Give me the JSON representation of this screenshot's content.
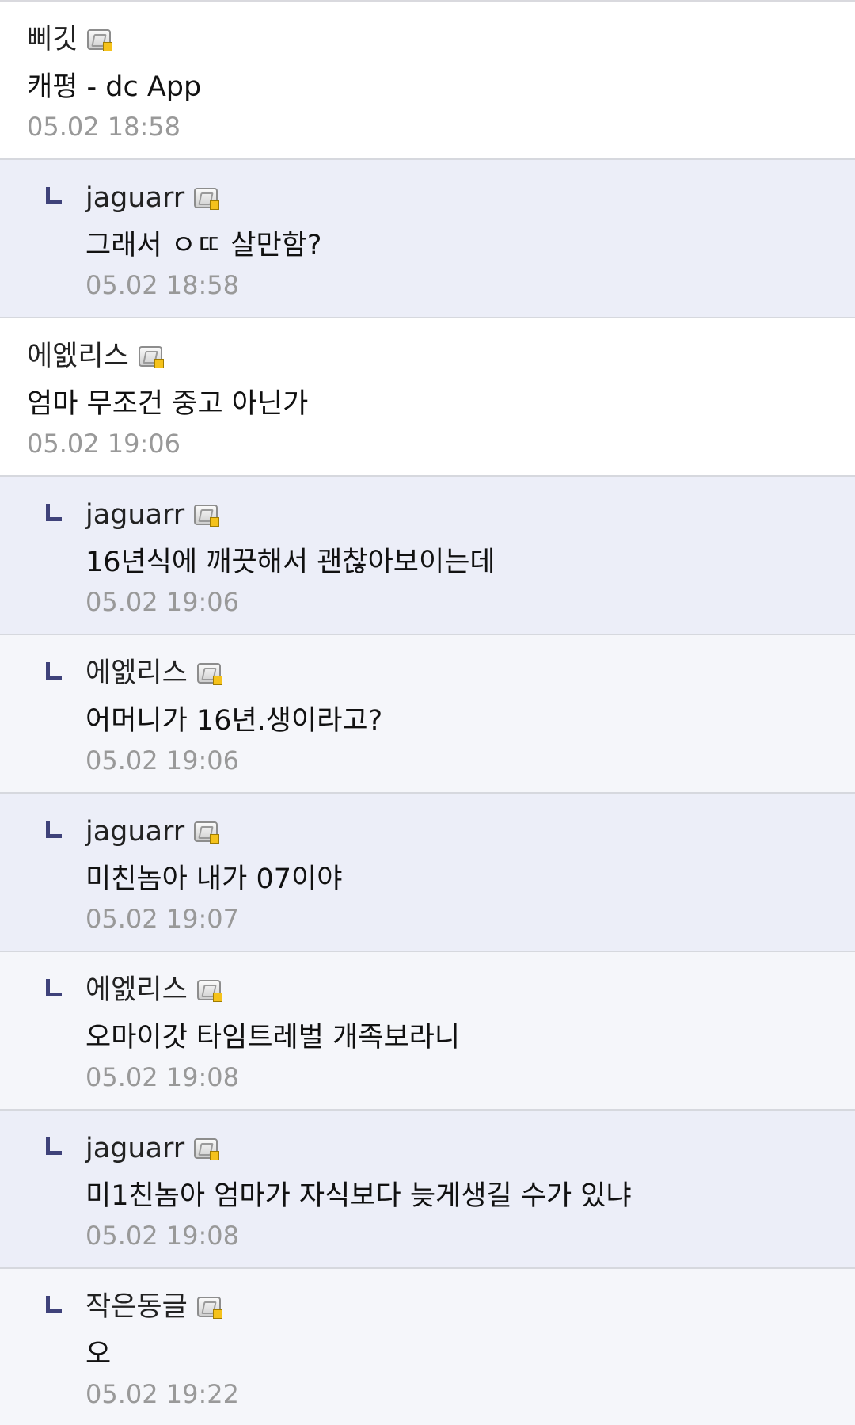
{
  "comments": [
    {
      "kind": "top",
      "nick": "삐깃",
      "text": "캐평 - dc App",
      "time": "05.02 18:58"
    },
    {
      "kind": "reply-author",
      "nick": "jaguarr",
      "text": "그래서 ㅇㄸ 살만함?",
      "time": "05.02 18:58"
    },
    {
      "kind": "top",
      "nick": "에엜리스",
      "text": "엄마 무조건 중고 아닌가",
      "time": "05.02 19:06"
    },
    {
      "kind": "reply-author",
      "nick": "jaguarr",
      "text": "16년식에 깨끗해서 괜찮아보이는데",
      "time": "05.02 19:06"
    },
    {
      "kind": "reply-other",
      "nick": "에엜리스",
      "text": "어머니가 16년.생이라고?",
      "time": "05.02 19:06"
    },
    {
      "kind": "reply-author",
      "nick": "jaguarr",
      "text": "미친놈아 내가 07이야",
      "time": "05.02 19:07"
    },
    {
      "kind": "reply-other",
      "nick": "에엜리스",
      "text": "오마이갓 타임트레벌 개족보라니",
      "time": "05.02 19:08"
    },
    {
      "kind": "reply-author",
      "nick": "jaguarr",
      "text": "미1친놈아 엄마가 자식보다 늦게생길 수가 있냐",
      "time": "05.02 19:08"
    },
    {
      "kind": "reply-other",
      "nick": "작은동글",
      "text": "오",
      "time": "05.02 19:22"
    }
  ],
  "icons": {
    "reply_marker": "reply-arrow-icon",
    "gallog": "gallog-icon"
  },
  "colors": {
    "reply_author_bg": "#eceef8",
    "reply_other_bg": "#f5f6fa",
    "reply_arrow": "#3f427a",
    "timestamp": "#999999"
  }
}
